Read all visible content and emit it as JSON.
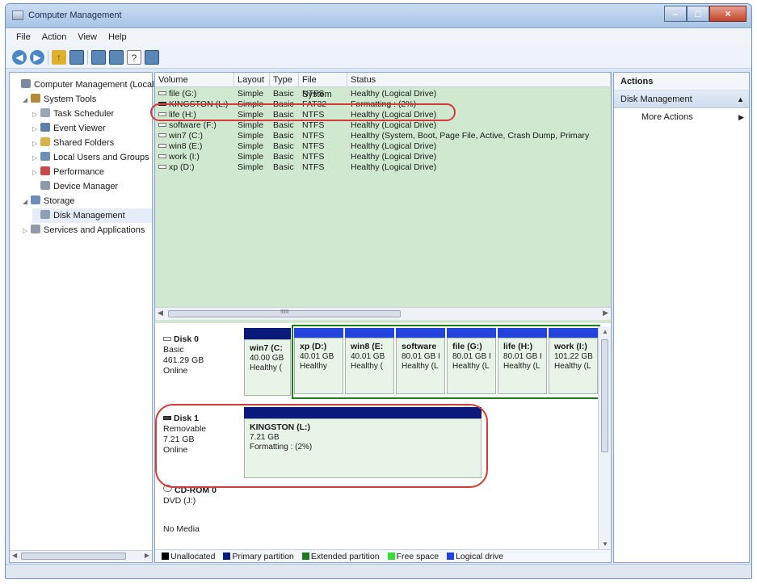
{
  "window": {
    "title": "Computer Management"
  },
  "menu": [
    "File",
    "Action",
    "View",
    "Help"
  ],
  "tree": {
    "items": [
      {
        "label": "Computer Management (Local",
        "indent": 0,
        "expand": "",
        "icon": "computer-management-icon",
        "color": "#7a8aa0"
      },
      {
        "label": "System Tools",
        "indent": 1,
        "expand": "◢",
        "icon": "toolbox-icon",
        "color": "#b48a3a"
      },
      {
        "label": "Task Scheduler",
        "indent": 2,
        "expand": "▷",
        "icon": "clock-icon",
        "color": "#9aa7b8"
      },
      {
        "label": "Event Viewer",
        "indent": 2,
        "expand": "▷",
        "icon": "event-viewer-icon",
        "color": "#5d7fa8"
      },
      {
        "label": "Shared Folders",
        "indent": 2,
        "expand": "▷",
        "icon": "shared-folder-icon",
        "color": "#d8b24a"
      },
      {
        "label": "Local Users and Groups",
        "indent": 2,
        "expand": "▷",
        "icon": "users-icon",
        "color": "#6d8fb5"
      },
      {
        "label": "Performance",
        "indent": 2,
        "expand": "▷",
        "icon": "performance-icon",
        "color": "#c74b4b"
      },
      {
        "label": "Device Manager",
        "indent": 2,
        "expand": "",
        "icon": "device-manager-icon",
        "color": "#8c9aaa"
      },
      {
        "label": "Storage",
        "indent": 1,
        "expand": "◢",
        "icon": "storage-icon",
        "color": "#6d8fb5"
      },
      {
        "label": "Disk Management",
        "indent": 2,
        "expand": "",
        "icon": "disk-management-icon",
        "color": "#8da0b5",
        "selected": true
      },
      {
        "label": "Services and Applications",
        "indent": 1,
        "expand": "▷",
        "icon": "services-icon",
        "color": "#8c9aaa"
      }
    ]
  },
  "volumes": {
    "headers": [
      "Volume",
      "Layout",
      "Type",
      "File System",
      "Status"
    ],
    "rows": [
      {
        "volume": "file (G:)",
        "layout": "Simple",
        "type": "Basic",
        "fs": "NTFS",
        "status": "Healthy (Logical Drive)",
        "usb": false
      },
      {
        "volume": "KINGSTON (L:)",
        "layout": "Simple",
        "type": "Basic",
        "fs": "FAT32",
        "status": "Formatting : (2%)",
        "usb": true
      },
      {
        "volume": "life (H:)",
        "layout": "Simple",
        "type": "Basic",
        "fs": "NTFS",
        "status": "Healthy (Logical Drive)",
        "usb": false
      },
      {
        "volume": "software (F:)",
        "layout": "Simple",
        "type": "Basic",
        "fs": "NTFS",
        "status": "Healthy (Logical Drive)",
        "usb": false
      },
      {
        "volume": "win7 (C:)",
        "layout": "Simple",
        "type": "Basic",
        "fs": "NTFS",
        "status": "Healthy (System, Boot, Page File, Active, Crash Dump, Primary",
        "usb": false
      },
      {
        "volume": "win8 (E:)",
        "layout": "Simple",
        "type": "Basic",
        "fs": "NTFS",
        "status": "Healthy (Logical Drive)",
        "usb": false
      },
      {
        "volume": "work (I:)",
        "layout": "Simple",
        "type": "Basic",
        "fs": "NTFS",
        "status": "Healthy (Logical Drive)",
        "usb": false
      },
      {
        "volume": "xp (D:)",
        "layout": "Simple",
        "type": "Basic",
        "fs": "NTFS",
        "status": "Healthy (Logical Drive)",
        "usb": false
      }
    ]
  },
  "disk0": {
    "name": "Disk 0",
    "kind": "Basic",
    "size": "461.29 GB",
    "state": "Online",
    "partitions": [
      {
        "name": "win7 (C:",
        "size": "40.00 GB",
        "status": "Healthy ("
      },
      {
        "name": "xp (D:)",
        "size": "40.01 GB",
        "status": "Healthy"
      },
      {
        "name": "win8 (E:",
        "size": "40.01 GB",
        "status": "Healthy ("
      },
      {
        "name": "software",
        "size": "80.01 GB I",
        "status": "Healthy (L"
      },
      {
        "name": "file (G:)",
        "size": "80.01 GB I",
        "status": "Healthy (L"
      },
      {
        "name": "life (H:)",
        "size": "80.01 GB I",
        "status": "Healthy (L"
      },
      {
        "name": "work (I:)",
        "size": "101.22 GB",
        "status": "Healthy (L"
      }
    ]
  },
  "disk1": {
    "name": "Disk 1",
    "kind": "Removable",
    "size": "7.21 GB",
    "state": "Online",
    "partition": {
      "name": "KINGSTON (L:)",
      "size": "7.21 GB",
      "status": "Formatting : (2%)"
    }
  },
  "cdrom": {
    "name": "CD-ROM 0",
    "drive": "DVD (J:)",
    "media": "No Media"
  },
  "scroll_marker": "ⅡⅡⅡ",
  "legend": [
    {
      "label": "Unallocated",
      "color": "#000000"
    },
    {
      "label": "Primary partition",
      "color": "#0a1a7a"
    },
    {
      "label": "Extended partition",
      "color": "#1e7a1e"
    },
    {
      "label": "Free space",
      "color": "#33dd33"
    },
    {
      "label": "Logical drive",
      "color": "#2244dd"
    }
  ],
  "actions": {
    "header": "Actions",
    "section": "Disk Management",
    "item": "More Actions"
  }
}
